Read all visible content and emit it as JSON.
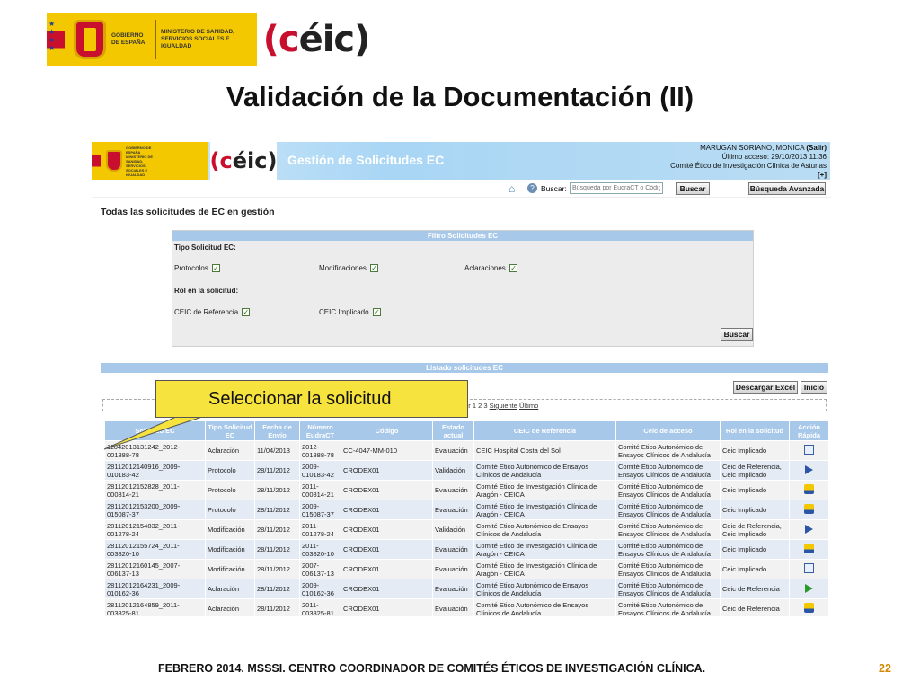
{
  "slide": {
    "gov_text": "GOBIERNO DE ESPAÑA",
    "ministry_text": "MINISTERIO DE SANIDAD, SERVICIOS SOCIALES E IGUALDAD",
    "ceic_logo_a": "(c",
    "ceic_logo_b": "éic)",
    "title": "Validación de la Documentación (II)",
    "footer": "FEBRERO 2014. MSSSI. CENTRO COORDINADOR DE COMITÉS ÉTICOS DE INVESTIGACIÓN CLÍNICA.",
    "page_number": "22",
    "callout": "Seleccionar la solicitud"
  },
  "app": {
    "mini_gov_text": "GOBIERNO DE ESPAÑA MINISTERIO DE SANIDAD, SERVICIOS SOCIALES E IGUALDAD",
    "title": "Gestión de Solicitudes EC",
    "user_name": "MARUGAN SORIANO, MONICA",
    "logout": "(Salir)",
    "last_access": "Último acceso: 29/10/2013 11:36",
    "committee": "Comité Ético de Investigación Clínica de Asturias",
    "expand": "[+]",
    "search_label": "Buscar:",
    "search_placeholder": "Búsqueda por EudraCT o Código",
    "search_button": "Buscar",
    "advanced_search_button": "Búsqueda Avanzada",
    "section_title": "Todas las solicitudes de EC en gestión",
    "filter": {
      "header": "Filtro Solicitudes EC",
      "type_label": "Tipo Solicitud EC:",
      "opt_protocolos": "Protocolos",
      "opt_modificaciones": "Modificaciones",
      "opt_aclaraciones": "Aclaraciones",
      "role_label": "Rol en la solicitud:",
      "opt_referencia": "CEIC de Referencia",
      "opt_implicado": "CEIC Implicado",
      "search_button": "Buscar"
    },
    "list_header": "Listado solicitudes EC",
    "excel_button": "Descargar Excel",
    "home_button": "Inicio",
    "pager": {
      "prefix": "ero Anterior 1 2 3",
      "next": "Siguiente",
      "last": "Último"
    },
    "columns": [
      "Solicitud EC",
      "Tipo Solicitud EC",
      "Fecha de Envío",
      "Número EudraCT",
      "Código",
      "Estado actual",
      "CEIC de Referencia",
      "Ceic de acceso",
      "Rol en la solicitud",
      "Acción Rápida"
    ],
    "rows": [
      {
        "id": "11042013131242_2012-001888-78",
        "type": "Aclaración",
        "date": "11/04/2013",
        "eudract": "2012-001888-78",
        "code": "CC-4047-MM-010",
        "status": "Evaluación",
        "ref": "CEIC Hospital Costa del Sol",
        "access": "Comité Etico Autonómico de Ensayos Clínicos de Andalucía",
        "role": "Ceic Implicado",
        "action": "doc-icon"
      },
      {
        "id": "28112012140916_2009-010183-42",
        "type": "Protocolo",
        "date": "28/11/2012",
        "eudract": "2009-010183-42",
        "code": "CRODEX01",
        "status": "Validación",
        "ref": "Comité Etico Autonómico de Ensayos Clínicos de Andalucía",
        "access": "Comité Etico Autonómico de Ensayos Clínicos de Andalucía",
        "role": "Ceic de Referencia, Ceic Implicado",
        "action": "arrow-icon"
      },
      {
        "id": "28112012152828_2011-000814-21",
        "type": "Protocolo",
        "date": "28/11/2012",
        "eudract": "2011-000814-21",
        "code": "CRODEX01",
        "status": "Evaluación",
        "ref": "Comité Etico de Investigación Clínica de Aragón - CEICA",
        "access": "Comité Etico Autonómico de Ensayos Clínicos de Andalucía",
        "role": "Ceic Implicado",
        "action": "thumb-icon"
      },
      {
        "id": "28112012153200_2009-015087-37",
        "type": "Protocolo",
        "date": "28/11/2012",
        "eudract": "2009-015087-37",
        "code": "CRODEX01",
        "status": "Evaluación",
        "ref": "Comité Etico de Investigación Clínica de Aragón - CEICA",
        "access": "Comité Etico Autonómico de Ensayos Clínicos de Andalucía",
        "role": "Ceic Implicado",
        "action": "thumb-icon"
      },
      {
        "id": "28112012154832_2011-001278-24",
        "type": "Modificación",
        "date": "28/11/2012",
        "eudract": "2011-001278-24",
        "code": "CRODEX01",
        "status": "Validación",
        "ref": "Comité Etico Autonómico de Ensayos Clínicos de Andalucía",
        "access": "Comité Etico Autonómico de Ensayos Clínicos de Andalucía",
        "role": "Ceic de Referencia, Ceic Implicado",
        "action": "arrow-icon"
      },
      {
        "id": "28112012155724_2011-003820-10",
        "type": "Modificación",
        "date": "28/11/2012",
        "eudract": "2011-003820-10",
        "code": "CRODEX01",
        "status": "Evaluación",
        "ref": "Comité Etico de Investigación Clínica de Aragón - CEICA",
        "access": "Comité Etico Autonómico de Ensayos Clínicos de Andalucía",
        "role": "Ceic Implicado",
        "action": "thumb-icon"
      },
      {
        "id": "28112012160145_2007-006137-13",
        "type": "Modificación",
        "date": "28/11/2012",
        "eudract": "2007-006137-13",
        "code": "CRODEX01",
        "status": "Evaluación",
        "ref": "Comité Etico de Investigación Clínica de Aragón - CEICA",
        "access": "Comité Etico Autonómico de Ensayos Clínicos de Andalucía",
        "role": "Ceic Implicado",
        "action": "doc-icon"
      },
      {
        "id": "28112012164231_2009-010162-36",
        "type": "Aclaración",
        "date": "28/11/2012",
        "eudract": "2009-010162-36",
        "code": "CRODEX01",
        "status": "Evaluación",
        "ref": "Comité Etico Autonómico de Ensayos Clínicos de Andalucía",
        "access": "Comité Etico Autonómico de Ensayos Clínicos de Andalucía",
        "role": "Ceic de Referencia",
        "action": "arrow-green-icon"
      },
      {
        "id": "28112012164859_2011-003825-81",
        "type": "Aclaración",
        "date": "28/11/2012",
        "eudract": "2011-003825-81",
        "code": "CRODEX01",
        "status": "Evaluación",
        "ref": "Comité Etico Autonómico de Ensayos Clínicos de Andalucía",
        "access": "Comité Etico Autonómico de Ensayos Clínicos de Andalucía",
        "role": "Ceic de Referencia",
        "action": "thumb-icon"
      }
    ]
  },
  "colors": {
    "header_blue": "#a8c8ea",
    "callout_yellow": "#f7e33d",
    "page_number": "#d38a00",
    "gov_yellow": "#f4c800"
  }
}
